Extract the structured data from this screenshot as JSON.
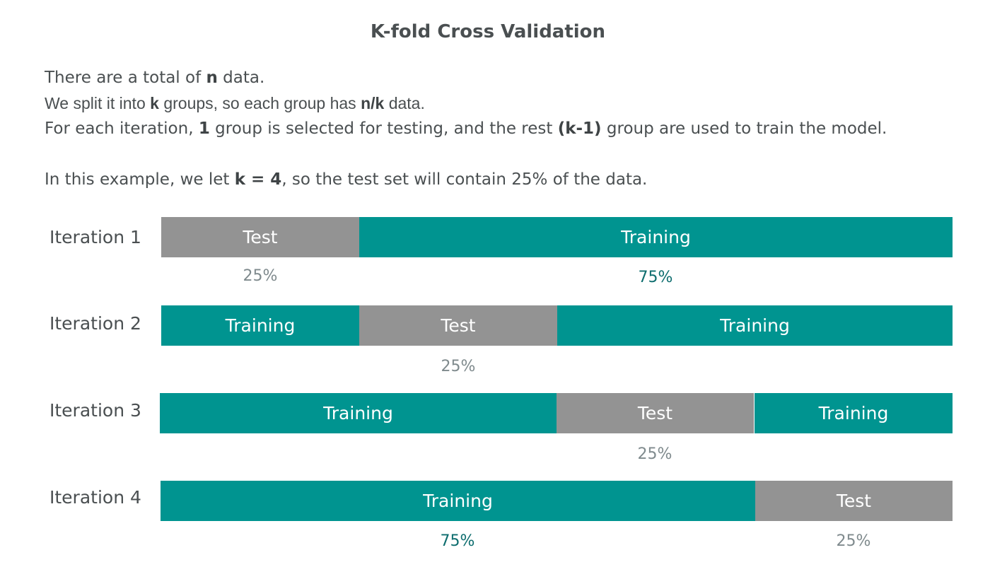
{
  "title": "K-fold Cross Validation",
  "description": {
    "line1": {
      "pre": "There are a total of ",
      "b1": "n",
      "post": " data."
    },
    "line2": {
      "pre": "We split it into ",
      "b1": "k",
      "mid": " groups, so each group has ",
      "b2": "n/k",
      "post": " data."
    },
    "line3": {
      "pre": "For each iteration, ",
      "b1": "1",
      "mid": " group is selected for testing, and the rest ",
      "b2": "(k-1)",
      "post": " group are used to train the model."
    },
    "line4": {
      "pre": "In this example, we let ",
      "b1": "k = 4",
      "post": ", so the test set will contain 25% of the data."
    }
  },
  "colors": {
    "test": "#939393",
    "training": "#009490",
    "pct_grey": "#7f8a8d",
    "pct_teal": "#0d6d6e"
  },
  "iterations": [
    {
      "label": "Iteration 1",
      "segments": [
        {
          "label": "Test"
        },
        {
          "label": "Training"
        }
      ],
      "percentages": [
        {
          "text": "25%"
        },
        {
          "text": "75%"
        }
      ]
    },
    {
      "label": "Iteration 2",
      "segments": [
        {
          "label": "Training"
        },
        {
          "label": "Test"
        },
        {
          "label": "Training"
        }
      ],
      "percentages": [
        {
          "text": "25%"
        }
      ]
    },
    {
      "label": "Iteration 3",
      "segments": [
        {
          "label": "Training"
        },
        {
          "label": "Test"
        },
        {
          "label": "Training"
        }
      ],
      "percentages": [
        {
          "text": "25%"
        }
      ]
    },
    {
      "label": "Iteration 4",
      "segments": [
        {
          "label": "Training"
        },
        {
          "label": "Test"
        }
      ],
      "percentages": [
        {
          "text": "75%"
        },
        {
          "text": "25%"
        }
      ]
    }
  ]
}
